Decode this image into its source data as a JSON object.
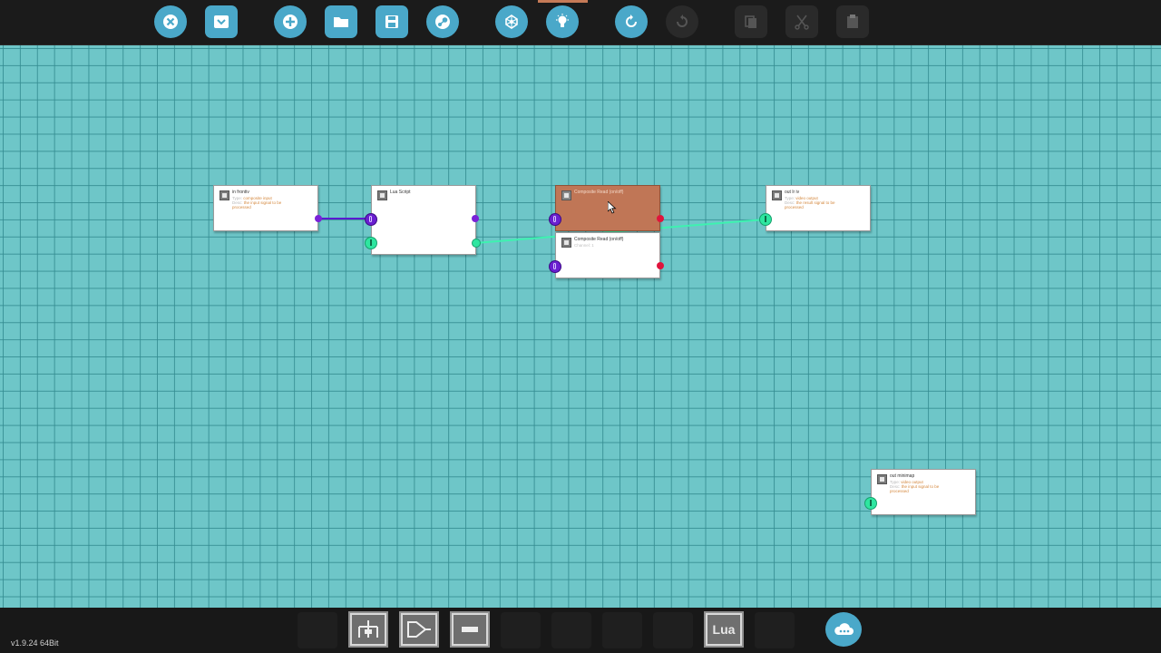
{
  "app": {
    "version": "v1.9.24 64Bit",
    "accent_color": "#4aa8c9",
    "canvas_color": "#6ec6c8"
  },
  "toolbar": {
    "buttons": [
      {
        "name": "close-button",
        "icon": "x-circle-icon",
        "enabled": true
      },
      {
        "name": "dropdown-button",
        "icon": "chevron-down-icon",
        "enabled": true
      },
      {
        "name": "new-button",
        "icon": "plus-icon",
        "enabled": true
      },
      {
        "name": "open-button",
        "icon": "folder-icon",
        "enabled": true
      },
      {
        "name": "save-button",
        "icon": "floppy-icon",
        "enabled": true
      },
      {
        "name": "steam-button",
        "icon": "steam-icon",
        "enabled": true
      },
      {
        "name": "fit-view-button",
        "icon": "network-icon",
        "enabled": true
      },
      {
        "name": "light-button",
        "icon": "lightbulb-icon",
        "enabled": true
      },
      {
        "name": "undo-button",
        "icon": "undo-icon",
        "enabled": true
      },
      {
        "name": "redo-button",
        "icon": "redo-icon",
        "enabled": false
      },
      {
        "name": "copy-button",
        "icon": "copy-icon",
        "enabled": false
      },
      {
        "name": "cut-button",
        "icon": "scissors-icon",
        "enabled": false
      },
      {
        "name": "paste-button",
        "icon": "paste-icon",
        "enabled": false
      }
    ]
  },
  "nodes": {
    "in_frontiv": {
      "title": "in frontiv",
      "type_label": "Type:",
      "type_value": "composite input",
      "desc_label": "Desc:",
      "desc_value": "the input signal to be",
      "desc_value2": "processed"
    },
    "lua_script": {
      "title": "Lua Script"
    },
    "composite_read_on": {
      "title": "Composite Read (on/off)",
      "subtitle": ""
    },
    "composite_read_2": {
      "title": "Composite Read (on/off)",
      "subtitle": "Channel: 1"
    },
    "out_lr_iv": {
      "title": "out lr iv",
      "type_label": "Type:",
      "type_value": "video output",
      "desc_label": "Desc:",
      "desc_value": "the result signal to be",
      "desc_value2": "processed"
    },
    "out_minimap": {
      "title": "out minimap",
      "type_label": "Type:",
      "type_value": "video output",
      "desc_label": "Desc:",
      "desc_value": "the input signal to be",
      "desc_value2": "processed"
    }
  },
  "bottombar": {
    "tools": [
      {
        "name": "logic-node-tool",
        "icon": "logic-gate-icon"
      },
      {
        "name": "arithmetic-node-tool",
        "icon": "arrow-gate-icon"
      },
      {
        "name": "constant-node-tool",
        "icon": "minus-block-icon"
      },
      {
        "name": "lua-node-tool",
        "icon": "lua-icon",
        "label": "Lua"
      }
    ],
    "cloud_icon": "cloud-icon"
  }
}
